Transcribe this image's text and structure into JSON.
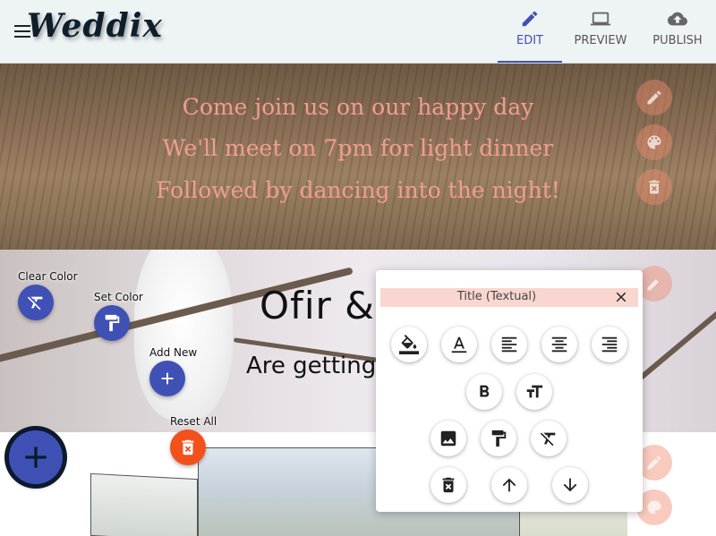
{
  "app": {
    "logo": "Weddix"
  },
  "nav": {
    "edit": "EDIT",
    "preview": "PREVIEW",
    "publish": "PUBLISH"
  },
  "invite": {
    "lines": [
      "Come join us on our happy day",
      "We'll meet on 7pm for light dinner",
      "Followed by dancing into the night!"
    ]
  },
  "title_section": {
    "title": "Ofir & Dor",
    "subtitle": "Are getting married"
  },
  "actions": {
    "clear_color": "Clear Color",
    "set_color": "Set Color",
    "add_new": "Add New",
    "reset_all": "Reset All"
  },
  "popup": {
    "title": "Title (Textual)"
  },
  "colors": {
    "accent": "#3f51b5",
    "danger": "#f2511b",
    "invite_text": "#f19d93",
    "popup_header": "#f9d6cf"
  },
  "icons": [
    "menu-icon",
    "pencil-icon",
    "monitor-icon",
    "cloud-upload-icon",
    "palette-icon",
    "delete-icon",
    "format-clear-icon",
    "format-paint-icon",
    "plus-icon",
    "fill-color-icon",
    "text-color-icon",
    "align-left-icon",
    "align-center-icon",
    "align-right-icon",
    "bold-icon",
    "text-size-icon",
    "image-icon",
    "arrow-up-icon",
    "arrow-down-icon",
    "close-icon"
  ]
}
